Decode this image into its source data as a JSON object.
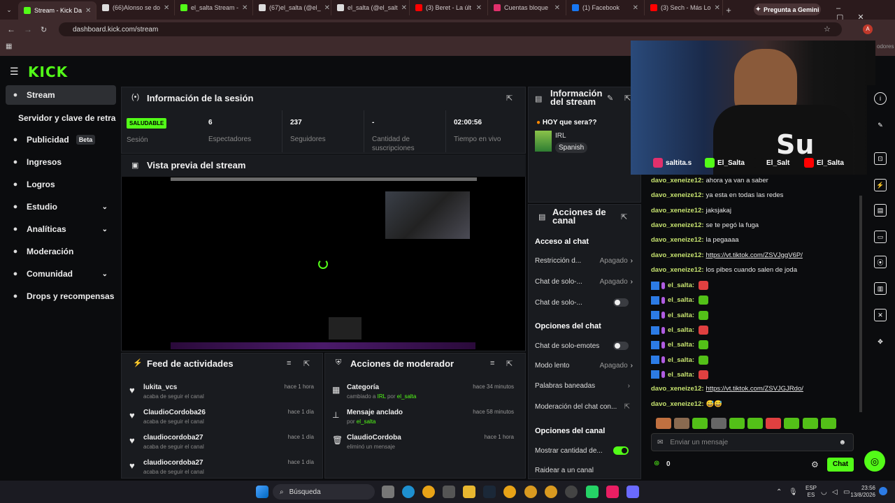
{
  "browser": {
    "tabs": [
      {
        "label": "Stream - Kick Da",
        "color": "#53fc18",
        "active": true
      },
      {
        "label": "(66)Alonso se do",
        "color": "#ddd"
      },
      {
        "label": "el_salta Stream -",
        "color": "#53fc18"
      },
      {
        "label": "(67)el_salta (@el_",
        "color": "#ddd"
      },
      {
        "label": "el_salta (@el_salt",
        "color": "#ddd"
      },
      {
        "label": "(3) Beret - La últ",
        "color": "#ff0000"
      },
      {
        "label": "Cuentas bloque",
        "color": "#e1306c"
      },
      {
        "label": "(1) Facebook",
        "color": "#1877f2"
      },
      {
        "label": "(3) Sech - Más Lo",
        "color": "#ff0000"
      }
    ],
    "gemini_label": "Pregunta a Gemini",
    "url": "dashboard.kick.com/stream",
    "bookmark_right": "odores"
  },
  "kick": {
    "logo": "KICK",
    "nav": [
      {
        "label": "Stream",
        "icon": "broadcast-icon",
        "active": true
      },
      {
        "label": "Servidor y clave de retransm",
        "icon": ""
      },
      {
        "label": "Publicidad",
        "icon": "ad-icon",
        "badge": "Beta"
      },
      {
        "label": "Ingresos",
        "icon": "money-icon"
      },
      {
        "label": "Logros",
        "icon": "trophy-icon"
      },
      {
        "label": "Estudio",
        "icon": "studio-icon",
        "chev": true
      },
      {
        "label": "Analíticas",
        "icon": "chart-icon",
        "chev": true
      },
      {
        "label": "Moderación",
        "icon": "wrench-icon"
      },
      {
        "label": "Comunidad",
        "icon": "community-icon",
        "chev": true
      },
      {
        "label": "Drops y recompensas",
        "icon": "gift-icon"
      }
    ],
    "session": {
      "title": "Información de la sesión",
      "health": "SALUDABLE",
      "health_label": "Sesión",
      "stats": [
        {
          "value": "6",
          "label": "Espectadores"
        },
        {
          "value": "237",
          "label": "Seguidores"
        },
        {
          "value": "-",
          "label": "Cantidad de suscripciones"
        },
        {
          "value": "02:00:56",
          "label": "Tiempo en vivo"
        }
      ]
    },
    "preview": {
      "title": "Vista previa del stream"
    },
    "stream_info": {
      "title": "Información del stream",
      "stream_title": "HOY que sera??",
      "category": "IRL",
      "language": "Spanish"
    },
    "channel_actions": {
      "title": "Acciones de canal",
      "chat_access": "Acceso al chat",
      "restriction": "Restricción d...",
      "restriction_state": "Apagado",
      "followers_only": "Chat de solo-...",
      "followers_only_state": "Apagado",
      "subs_only": "Chat de solo-...",
      "chat_options": "Opciones del chat",
      "emotes_only": "Chat de solo-emotes",
      "slow_mode": "Modo lento",
      "slow_mode_state": "Apagado",
      "banned_words": "Palabras baneadas",
      "moderation": "Moderación del chat con...",
      "channel_options": "Opciones del canal",
      "show_subs": "Mostrar cantidad de...",
      "raid": "Raidear a un canal"
    },
    "feed": {
      "title": "Feed de actividades",
      "items": [
        {
          "name": "lukita_vcs",
          "sub": "acaba de seguir el canal",
          "time": "hace 1 hora"
        },
        {
          "name": "ClaudioCordoba26",
          "sub": "acaba de seguir el canal",
          "time": "hace 1 día"
        },
        {
          "name": "claudiocordoba27",
          "sub": "acaba de seguir el canal",
          "time": "hace 1 día"
        },
        {
          "name": "claudiocordoba27",
          "sub": "acaba de seguir el canal",
          "time": "hace 1 día"
        }
      ]
    },
    "mod_actions": {
      "title": "Acciones de moderador",
      "items": [
        {
          "name": "Categoría",
          "sub_pre": "cambiado a ",
          "sub_hl": "IRL",
          "sub_mid": " por ",
          "sub_user": "el_salta",
          "time": "hace 34 minutos"
        },
        {
          "name": "Mensaje anclado",
          "sub_pre": "por ",
          "sub_user": "el_salta",
          "time": "hace 58 minutos"
        },
        {
          "name": "ClaudioCordoba",
          "sub_pre": "eliminó un mensaje",
          "time": "hace 1 hora"
        }
      ]
    },
    "chat": {
      "lines": [
        {
          "user": "davo_xeneize12:",
          "text": "ahora ya van a saber"
        },
        {
          "user": "davo_xeneize12:",
          "text": "ya esta en todas las redes"
        },
        {
          "user": "davo_xeneize12:",
          "text": "jaksjakaj"
        },
        {
          "user": "davo_xeneize12:",
          "text": "se te pegó la fuga"
        },
        {
          "user": "davo_xeneize12:",
          "text": "la pegaaaa"
        },
        {
          "user": "davo_xeneize12:",
          "link": "https://vt.tiktok.com/ZSVJggV6P/"
        },
        {
          "user": "davo_xeneize12:",
          "text": "los pibes cuando salen de joda"
        },
        {
          "user": "el_salta:",
          "emote": "#e04040",
          "badges": true
        },
        {
          "user": "el_salta:",
          "emote": "#53c018",
          "badges": true
        },
        {
          "user": "el_salta:",
          "emote": "#53c018",
          "badges": true
        },
        {
          "user": "el_salta:",
          "emote": "#e04040",
          "badges": true
        },
        {
          "user": "el_salta:",
          "emote": "#53c018",
          "badges": true
        },
        {
          "user": "el_salta:",
          "emote": "#53c018",
          "badges": true
        },
        {
          "user": "el_salta:",
          "emote": "#e04040",
          "badges": true
        },
        {
          "user": "davo_xeneize12:",
          "link": "https://vt.tiktok.com/ZSVJGJRdo/"
        },
        {
          "user": "davo_xeneize12:",
          "text": "😅😅"
        }
      ],
      "placeholder": "Enviar un mensaje",
      "count": "0",
      "send": "Chat"
    },
    "overlay": {
      "socials": [
        "saltita.s",
        "El_Salta",
        "El_Salt",
        "El_Salta"
      ]
    }
  },
  "taskbar": {
    "search": "Búsqueda",
    "lang": "ESP",
    "lang2": "ES",
    "time": "23:56",
    "date": "13/8/2026"
  }
}
